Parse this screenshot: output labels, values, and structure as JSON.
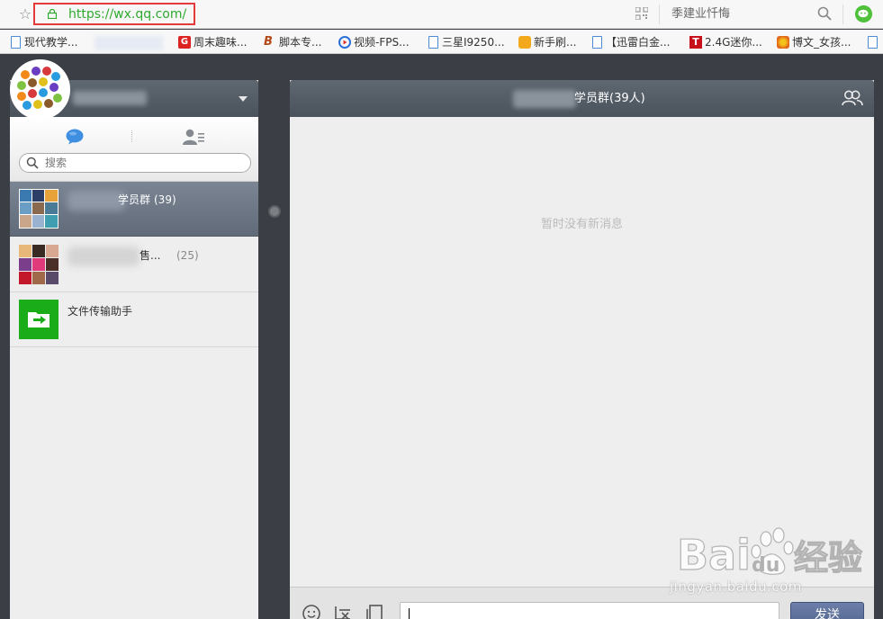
{
  "browser": {
    "url": "https://wx.qq.com/",
    "search_box_text": "季建业忏悔",
    "bookmarks": [
      {
        "label": "现代教学...",
        "icon": "document-icon"
      },
      {
        "label": "",
        "icon": "blurred"
      },
      {
        "label": "周末趣味...",
        "icon": "g-logo-icon"
      },
      {
        "label": "脚本专...",
        "icon": "b-logo-icon"
      },
      {
        "label": "视频-FPS...",
        "icon": "play-icon"
      },
      {
        "label": "三星I9250...",
        "icon": "document-icon"
      },
      {
        "label": "新手刷...",
        "icon": "sync-icon"
      },
      {
        "label": "【迅雷白金...",
        "icon": "document-icon"
      },
      {
        "label": "2.4G迷你...",
        "icon": "t-logo-icon"
      },
      {
        "label": "博文_女孩...",
        "icon": "leaf-icon"
      },
      {
        "label": "",
        "icon": "document-icon"
      }
    ]
  },
  "sidebar": {
    "search_placeholder": "搜索",
    "chats": [
      {
        "name": "学员群",
        "count": "(39)",
        "active": true
      },
      {
        "name": "售...",
        "count": "(25)",
        "active": false
      },
      {
        "name": "文件传输助手",
        "count": "",
        "active": false
      }
    ]
  },
  "chat": {
    "title": "学员群(39人)",
    "empty_text": "暂时没有新消息",
    "send_label": "发送"
  },
  "watermark": {
    "logo_text": "Baidu经验",
    "url": "jingyan.baidu.com"
  },
  "colors": {
    "header_bg": "#4f5761",
    "active_item_bg": "#6b7583",
    "send_button": "#5a6d97",
    "url_green": "#2fa92f",
    "highlight_red": "#e33b3b"
  }
}
